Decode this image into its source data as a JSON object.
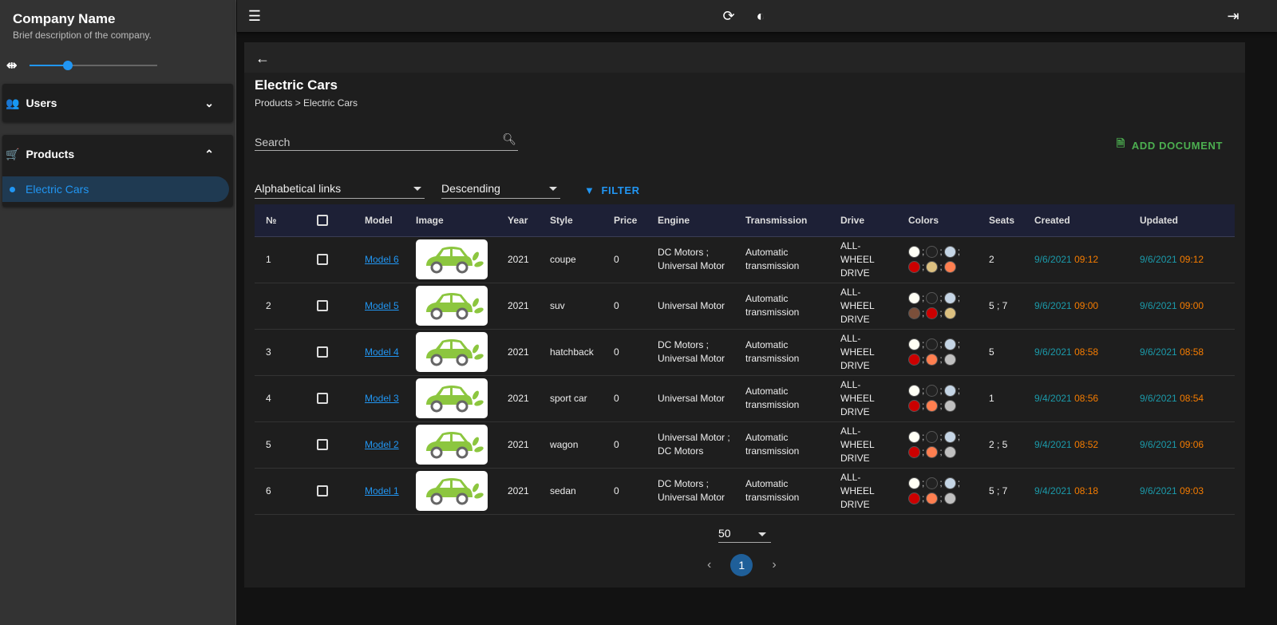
{
  "sidebar": {
    "company": "Company Name",
    "description": "Brief description of the company.",
    "width_slider": {
      "value": 0.3
    },
    "sections": [
      {
        "label": "Users",
        "icon": "users-icon",
        "expanded": false
      },
      {
        "label": "Products",
        "icon": "cart-icon",
        "expanded": true,
        "items": [
          {
            "label": "Electric Cars",
            "active": true
          }
        ]
      }
    ]
  },
  "topbar": {
    "icons": [
      "menu-icon",
      "refresh-icon",
      "brightness-icon",
      "logout-icon"
    ]
  },
  "page": {
    "title": "Electric Cars",
    "breadcrumb": "Products > Electric Cars",
    "search_placeholder": "Search",
    "add_label": "ADD DOCUMENT",
    "sort_field": "Alphabetical links",
    "sort_order": "Descending",
    "filter_label": "FILTER"
  },
  "table": {
    "headers": [
      "№",
      "",
      "Model",
      "Image",
      "Year",
      "Style",
      "Price",
      "Engine",
      "Transmission",
      "Drive",
      "Colors",
      "Seats",
      "Created",
      "Updated"
    ],
    "rows": [
      {
        "n": "1",
        "model": "Model 6",
        "year": "2021",
        "style": "coupe",
        "price": "0",
        "engine": "DC Motors ; Universal Motor",
        "transmission": "Automatic transmission",
        "drive": "ALL-WHEEL DRIVE",
        "colors": [
          "#fffff5",
          "#222222",
          "#c5d5e5",
          "#cc0000",
          "#dcc080",
          "#ff7f50"
        ],
        "seats": "2",
        "created_date": "9/6/2021",
        "created_time": "09:12",
        "updated_date": "9/6/2021",
        "updated_time": "09:12"
      },
      {
        "n": "2",
        "model": "Model 5",
        "year": "2021",
        "style": "suv",
        "price": "0",
        "engine": "Universal Motor",
        "transmission": "Automatic transmission",
        "drive": "ALL-WHEEL DRIVE",
        "colors": [
          "#fffff5",
          "#222222",
          "#c5d5e5",
          "#7a4f3a",
          "#cc0000",
          "#dcc080"
        ],
        "seats": "5 ; 7",
        "created_date": "9/6/2021",
        "created_time": "09:00",
        "updated_date": "9/6/2021",
        "updated_time": "09:00"
      },
      {
        "n": "3",
        "model": "Model 4",
        "year": "2021",
        "style": "hatchback",
        "price": "0",
        "engine": "DC Motors ; Universal Motor",
        "transmission": "Automatic transmission",
        "drive": "ALL-WHEEL DRIVE",
        "colors": [
          "#fffff5",
          "#222222",
          "#c5d5e5",
          "#cc0000",
          "#ff7f50",
          "#c0c0c0"
        ],
        "seats": "5",
        "created_date": "9/6/2021",
        "created_time": "08:58",
        "updated_date": "9/6/2021",
        "updated_time": "08:58"
      },
      {
        "n": "4",
        "model": "Model 3",
        "year": "2021",
        "style": "sport car",
        "price": "0",
        "engine": "Universal Motor",
        "transmission": "Automatic transmission",
        "drive": "ALL-WHEEL DRIVE",
        "colors": [
          "#fffff5",
          "#222222",
          "#c5d5e5",
          "#cc0000",
          "#ff7f50",
          "#c0c0c0"
        ],
        "seats": "1",
        "created_date": "9/4/2021",
        "created_time": "08:56",
        "updated_date": "9/6/2021",
        "updated_time": "08:54"
      },
      {
        "n": "5",
        "model": "Model 2",
        "year": "2021",
        "style": "wagon",
        "price": "0",
        "engine": "Universal Motor ; DC Motors",
        "transmission": "Automatic transmission",
        "drive": "ALL-WHEEL DRIVE",
        "colors": [
          "#fffff5",
          "#222222",
          "#c5d5e5",
          "#cc0000",
          "#ff7f50",
          "#c0c0c0"
        ],
        "seats": "2 ; 5",
        "created_date": "9/4/2021",
        "created_time": "08:52",
        "updated_date": "9/6/2021",
        "updated_time": "09:06"
      },
      {
        "n": "6",
        "model": "Model 1",
        "year": "2021",
        "style": "sedan",
        "price": "0",
        "engine": "DC Motors ; Universal Motor",
        "transmission": "Automatic transmission",
        "drive": "ALL-WHEEL DRIVE",
        "colors": [
          "#fffff5",
          "#222222",
          "#c5d5e5",
          "#cc0000",
          "#ff7f50",
          "#c0c0c0"
        ],
        "seats": "5 ; 7",
        "created_date": "9/4/2021",
        "created_time": "08:18",
        "updated_date": "9/6/2021",
        "updated_time": "09:03"
      }
    ]
  },
  "pagination": {
    "page_size": "50",
    "current_page": "1"
  }
}
